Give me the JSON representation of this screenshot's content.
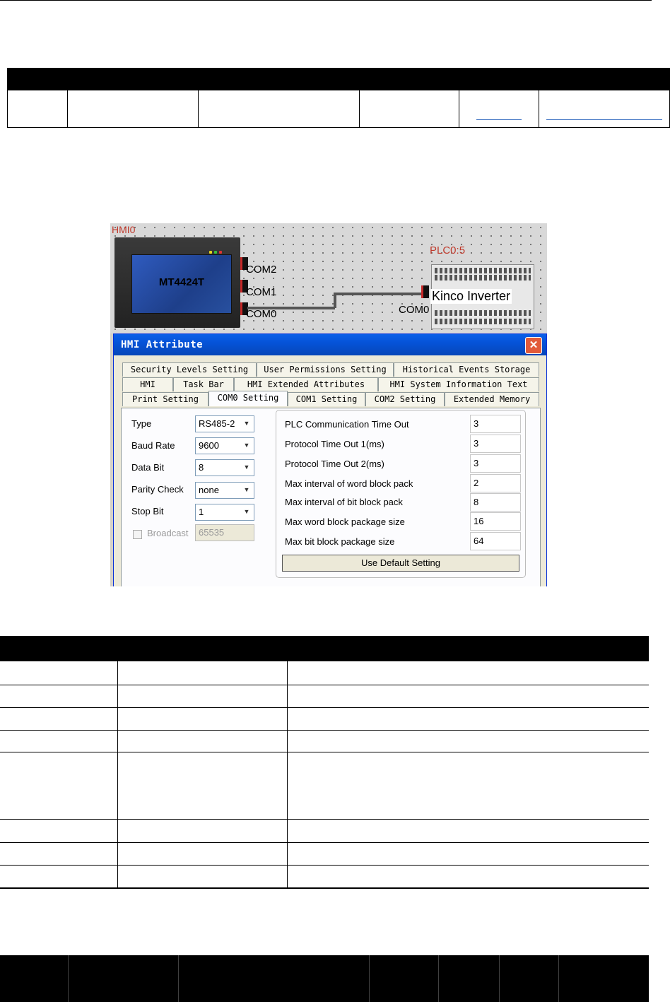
{
  "screenshot": {
    "hmi": {
      "label": "HMI0",
      "model": "MT4424T",
      "ports": [
        "COM2",
        "COM1",
        "COM0"
      ]
    },
    "plc": {
      "label": "PLC0:5",
      "name": "Kinco Inverter",
      "port": "COM0"
    },
    "dialog": {
      "title": "HMI Attribute",
      "close_symbol": "✕",
      "tabs_row1": [
        "Security Levels Setting",
        "User Permissions Setting",
        "Historical Events Storage"
      ],
      "tabs_row2": [
        "HMI",
        "Task Bar",
        "HMI Extended Attributes",
        "HMI System Information Text"
      ],
      "tabs_row3": [
        "Print Setting",
        "COM0 Setting",
        "COM1 Setting",
        "COM2 Setting",
        "Extended Memory"
      ],
      "active_tab": "COM0 Setting",
      "fields": [
        {
          "label": "Type",
          "value": "RS485-2"
        },
        {
          "label": "Baud Rate",
          "value": "9600"
        },
        {
          "label": "Data Bit",
          "value": "8"
        },
        {
          "label": "Parity Check",
          "value": "none"
        },
        {
          "label": "Stop Bit",
          "value": "1"
        }
      ],
      "broadcast": {
        "label": "Broadcast",
        "value": "65535",
        "checked": false
      },
      "timeouts": [
        {
          "label": "PLC Communication Time Out",
          "value": "3"
        },
        {
          "label": "Protocol Time Out 1(ms)",
          "value": "3"
        },
        {
          "label": "Protocol Time Out 2(ms)",
          "value": "3"
        },
        {
          "label": "Max interval of word block pack",
          "value": "2"
        },
        {
          "label": "Max interval of bit block pack",
          "value": "8"
        },
        {
          "label": "Max word block package size",
          "value": "16"
        },
        {
          "label": "Max bit block package size",
          "value": "64"
        }
      ],
      "default_button": "Use Default Setting"
    }
  }
}
